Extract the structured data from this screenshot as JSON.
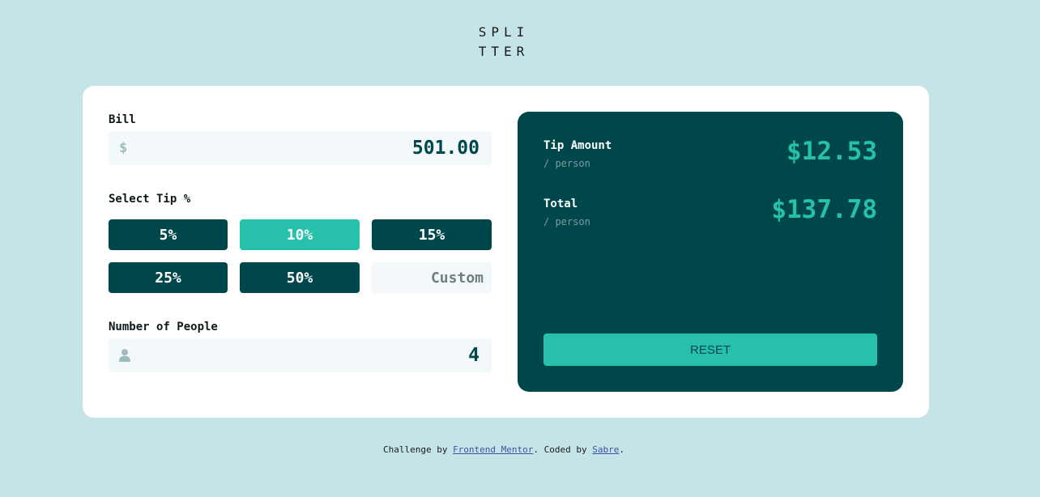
{
  "logo": {
    "line1": "SPLI",
    "line2": "TTER"
  },
  "bill": {
    "label": "Bill",
    "currency_symbol": "$",
    "value": "501.00"
  },
  "tip": {
    "label": "Select Tip %",
    "options": [
      "5%",
      "10%",
      "15%",
      "25%",
      "50%"
    ],
    "selected": "10%",
    "custom_placeholder": "Custom"
  },
  "people": {
    "label": "Number of People",
    "value": "4"
  },
  "results": {
    "tip_label": "Tip Amount",
    "tip_sub": "/ person",
    "tip_amount": "$12.53",
    "total_label": "Total",
    "total_sub": "/ person",
    "total_amount": "$137.78",
    "reset_label": "RESET"
  },
  "footer": {
    "prefix": "Challenge by ",
    "link1": "Frontend Mentor",
    "middle": ". Coded by ",
    "link2": "Sabre",
    "suffix": "."
  },
  "colors": {
    "background": "#c5e4e7",
    "dark_cyan": "#00474b",
    "strong_cyan": "#26c0ab",
    "input_bg": "#f3f9fa"
  }
}
